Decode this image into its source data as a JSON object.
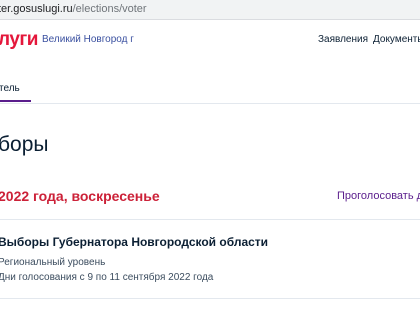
{
  "browser": {
    "url_host": "ter.gosuslugi.ru",
    "url_path": "/elections/voter"
  },
  "header": {
    "logo": "луги",
    "region": "Великий Новгород г",
    "nav": {
      "statements": "Заявления",
      "documents": "Документы"
    }
  },
  "tabs": {
    "voter": "тель"
  },
  "page": {
    "title": "боры"
  },
  "election": {
    "date": "2022 года, воскресенье",
    "vote_link": "Проголосовать дис",
    "title": "Выборы Губернатора Новгородской области",
    "level": "Региональный уровень",
    "dates": "Дни голосования с 9 по 11 сентября 2022 года"
  },
  "colors": {
    "brand_red": "#e4173b",
    "date_red": "#cc2138",
    "accent_purple": "#5a1d8c",
    "link_blue": "#3a50a0"
  }
}
